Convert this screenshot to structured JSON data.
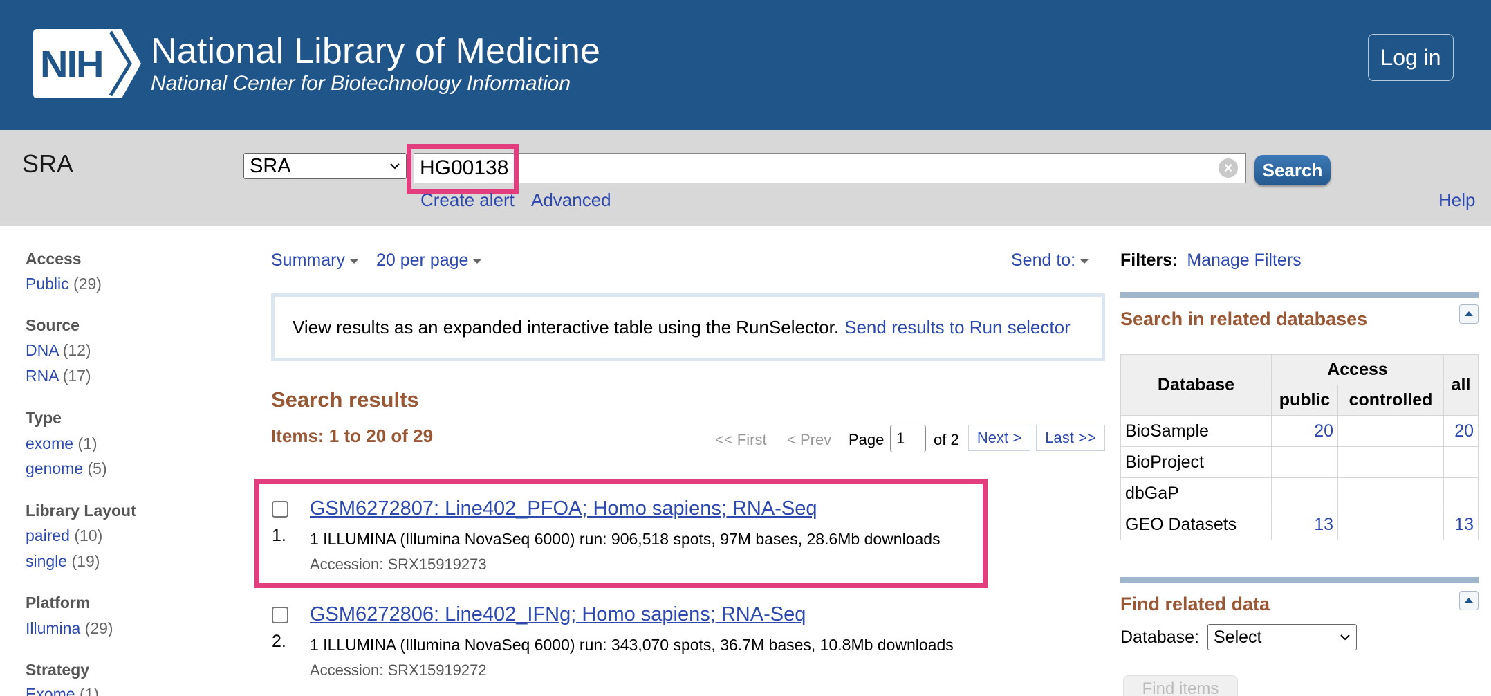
{
  "header": {
    "logo_text": "NIH",
    "title": "National Library of Medicine",
    "subtitle": "National Center for Biotechnology Information",
    "login_label": "Log in"
  },
  "search": {
    "db_name": "SRA",
    "db_select_value": "SRA",
    "term": "HG00138",
    "button_label": "Search",
    "create_alert": "Create alert",
    "advanced": "Advanced",
    "help": "Help"
  },
  "sidebar": {
    "facets": [
      {
        "heading": "Access",
        "items": [
          {
            "label": "Public",
            "count": "(29)"
          }
        ]
      },
      {
        "heading": "Source",
        "items": [
          {
            "label": "DNA",
            "count": "(12)"
          },
          {
            "label": "RNA",
            "count": "(17)"
          }
        ]
      },
      {
        "heading": "Type",
        "items": [
          {
            "label": "exome",
            "count": "(1)"
          },
          {
            "label": "genome",
            "count": "(5)"
          }
        ]
      },
      {
        "heading": "Library Layout",
        "items": [
          {
            "label": "paired",
            "count": "(10)"
          },
          {
            "label": "single",
            "count": "(19)"
          }
        ]
      },
      {
        "heading": "Platform",
        "items": [
          {
            "label": "Illumina",
            "count": "(29)"
          }
        ]
      },
      {
        "heading": "Strategy",
        "items": [
          {
            "label": "Exome",
            "count": "(1)"
          }
        ]
      }
    ]
  },
  "controls": {
    "format": "Summary",
    "per_page": "20 per page",
    "send_to": "Send to:"
  },
  "runselector": {
    "text": "View results as an expanded interactive table using the RunSelector.",
    "link": "Send results to Run selector"
  },
  "results": {
    "title": "Search results",
    "items_label": "Items: 1 to 20 of 29",
    "pager": {
      "first": "<< First",
      "prev": "< Prev",
      "page_label": "Page",
      "page_value": "1",
      "of_label": "of 2",
      "next": "Next >",
      "last": "Last >>"
    },
    "list": [
      {
        "num": "1.",
        "title": "GSM6272807: Line402_PFOA; Homo sapiens; RNA-Seq",
        "desc": "1 ILLUMINA (Illumina NovaSeq 6000) run: 906,518 spots, 97M bases, 28.6Mb downloads",
        "accession": "Accession: SRX15919273"
      },
      {
        "num": "2.",
        "title": "GSM6272806: Line402_IFNg; Homo sapiens; RNA-Seq",
        "desc": "1 ILLUMINA (Illumina NovaSeq 6000) run: 343,070 spots, 36.7M bases, 10.8Mb downloads",
        "accession": "Accession: SRX15919272"
      }
    ]
  },
  "right": {
    "filters_label": "Filters:",
    "manage_filters": "Manage Filters",
    "related_title": "Search in related databases",
    "table": {
      "col_database": "Database",
      "col_access": "Access",
      "col_all": "all",
      "col_public": "public",
      "col_controlled": "controlled",
      "rows": [
        {
          "db": "BioSample",
          "public": "20",
          "controlled": "",
          "all": "20"
        },
        {
          "db": "BioProject",
          "public": "",
          "controlled": "",
          "all": ""
        },
        {
          "db": "dbGaP",
          "public": "",
          "controlled": "",
          "all": ""
        },
        {
          "db": "GEO Datasets",
          "public": "13",
          "controlled": "",
          "all": "13"
        }
      ]
    },
    "find_title": "Find related data",
    "database_label": "Database:",
    "database_select": "Select",
    "find_button": "Find items"
  },
  "colors": {
    "header_bg": "#20558a",
    "accent_brown": "#985735",
    "link_blue": "#2d49ad",
    "highlight_pink": "#e23d7c"
  }
}
